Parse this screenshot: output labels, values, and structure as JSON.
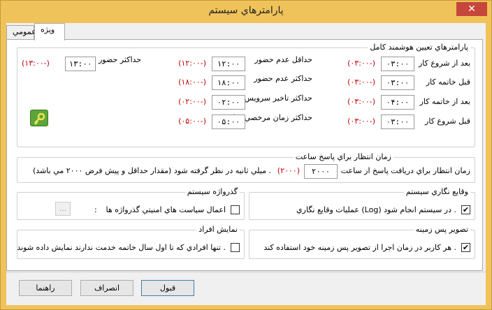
{
  "window": {
    "title": "پارامترهاي سيستم",
    "close_glyph": "✕"
  },
  "tabs": [
    {
      "label": "ويژه"
    },
    {
      "label": "عمومي"
    }
  ],
  "smart_params": {
    "title": "پارامترهاي تعيين هوشمند کامل",
    "right_rows": [
      {
        "label": "بعد از شروع کار",
        "value": "۰۳:۰۰",
        "hint": "(۰۳:۰۰-)"
      },
      {
        "label": "قبل خاتمه کار",
        "value": "۰۳:۰۰",
        "hint": "(۰۳:۰۰-)"
      },
      {
        "label": "بعد از خاتمه کار",
        "value": "۰۴:۰۰",
        "hint": "(۰۳:۰۰-)"
      },
      {
        "label": "قبل شروع کار",
        "value": "۰۳:۰۰",
        "hint": "(۰۳:۰۰-)"
      }
    ],
    "middle_rows": [
      {
        "label": "حداقل عدم حضور",
        "value": "۱۲:۰۰",
        "hint": "(۱۲:۰۰-)"
      },
      {
        "label": "حداکثر عدم حضور",
        "value": "۱۸:۰۰",
        "hint": "(۱۸:۰۰-)"
      },
      {
        "label": "حداکثر تاخير سرويس",
        "value": "۰۲:۰۰",
        "hint": "(۰۲:۰۰-)"
      },
      {
        "label": "حداکثر زمان مرخصي ساعتي",
        "value": "۰۵:۰۰",
        "hint": "(۰۵:۰۰-)"
      }
    ],
    "left_row": {
      "label": "حداکثر حضور",
      "value": "۱۳:۰۰",
      "hint": "(۱۳:۰۰-)"
    }
  },
  "wait_time": {
    "title": "زمان انتظار براي پاسخ ساعت",
    "label": "زمان انتظار براي دريافت پاسخ از ساعت",
    "value": "۲۰۰۰",
    "hint": "(۲۰۰۰)",
    "suffix": "ميلي ثانيه در نظر گرفته شود (مقدار حداقل و پيش فرض ۲۰۰۰ مي باشد) ."
  },
  "logging": {
    "title": "وقايع نگاري سيستم",
    "label": "عمليات وقايع نگاري (Log) در سيستم انجام شود .",
    "checked": true
  },
  "password": {
    "title": "گذرواژه سيستم",
    "label": "اعمال سياست هاي امنيتي گذرواژه ها",
    "colon": ":",
    "browse": "..."
  },
  "wallpaper": {
    "title": "تصوير پس زمينه",
    "label": "هر کاربر در زمان اجرا از تصوير پس زمينه خود استفاده کند .",
    "checked": true
  },
  "people": {
    "title": "نمايش افراد",
    "label": "تنها افرادي که تا اول سال خاتمه خدمت ندارند نمايش داده شوند ."
  },
  "buttons": {
    "ok": "قبول",
    "cancel": "انصراف",
    "help": "راهنما"
  },
  "colors": {
    "titlebar": "#f0c25a",
    "close": "#c7463b",
    "hint_red": "#c00000"
  }
}
